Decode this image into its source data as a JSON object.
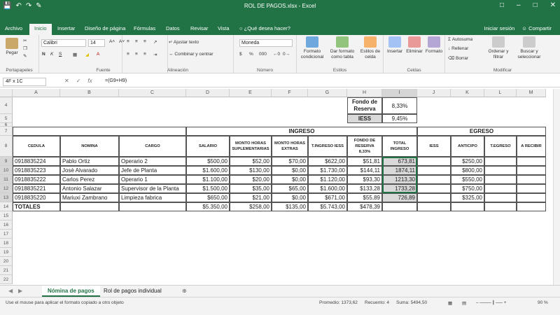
{
  "window": {
    "title": "ROL DE PAGOS.xlsx - Excel"
  },
  "tabs": [
    "Archivo",
    "Inicio",
    "Insertar",
    "Diseño de página",
    "Fórmulas",
    "Datos",
    "Revisar",
    "Vista"
  ],
  "tell_me": "¿Qué desea hacer?",
  "account": {
    "signin": "Iniciar sesión",
    "share": "Compartir"
  },
  "ribbon": {
    "clipboard": {
      "label": "Portapapeles",
      "paste": "Pegar"
    },
    "font": {
      "label": "Fuente",
      "name": "Calibri",
      "size": "14"
    },
    "alignment": {
      "label": "Alineación",
      "wrap": "Ajustar texto",
      "merge": "Combinar y centrar"
    },
    "number": {
      "label": "Número",
      "format": "Moneda"
    },
    "styles": {
      "label": "Estilos",
      "cond": "Formato condicional",
      "table": "Dar formato como tabla",
      "cell": "Estilos de celda"
    },
    "cells": {
      "label": "Celdas",
      "insert": "Insertar",
      "delete": "Eliminar",
      "format": "Formato"
    },
    "editing": {
      "label": "Modificar",
      "autosum": "Autosuma",
      "fill": "Rellenar",
      "clear": "Borrar",
      "sort": "Ordenar y filtrar",
      "find": "Buscar y seleccionar"
    }
  },
  "formula_bar": {
    "name_box": "4F x 1C",
    "formula": "=(G9+H9)"
  },
  "columns": [
    "A",
    "B",
    "C",
    "D",
    "E",
    "F",
    "G",
    "H",
    "I",
    "J",
    "K",
    "L",
    "M"
  ],
  "rows": [
    "4",
    "5",
    "6",
    "7",
    "8",
    "9",
    "10",
    "11",
    "12",
    "13",
    "14",
    "15",
    "16",
    "17",
    "18",
    "19",
    "20",
    "21",
    "22"
  ],
  "top_block": {
    "fondo_label": "Fondo de Reserva",
    "fondo_value": "8,33%",
    "iess_label": "IESS",
    "iess_value": "9,45%"
  },
  "ingreso_title": "INGRESO",
  "egreso_title": "EGRESO",
  "headers": [
    "CEDULA",
    "NOMINA",
    "CARGO",
    "SALARIO",
    "MONTO HORAS SUPLEMENTARIAS",
    "MONTO HORAS EXTRAS",
    "T.INGRESO IESS",
    "FONDO DE RESERVA 8,33%",
    "TOTAL INGRESO",
    "IESS",
    "ANTICIPO",
    "T.EGRESO",
    "A RECIBIR"
  ],
  "data": [
    [
      "0918835224",
      "Pablo Ortiz",
      "Operario 2",
      "$500,00",
      "$52,00",
      "$70,00",
      "$622,00",
      "$51,81",
      "673,81",
      "",
      "$250,00",
      "",
      ""
    ],
    [
      "0918835223",
      "Josè Alvarado",
      "Jefe de Planta",
      "$1.600,00",
      "$130,00",
      "$0,00",
      "$1.730,00",
      "$144,11",
      "1874,11",
      "",
      "$800,00",
      "",
      ""
    ],
    [
      "0918835222",
      "Carlos Perez",
      "Operario 1",
      "$1.100,00",
      "$20,00",
      "$0,00",
      "$1.120,00",
      "$93,30",
      "1213,30",
      "",
      "$550,00",
      "",
      ""
    ],
    [
      "0918835221",
      "Antonio Salazar",
      "Supervisor de la Planta",
      "$1.500,00",
      "$35,00",
      "$65,00",
      "$1.600,00",
      "$133,28",
      "1733,28",
      "",
      "$750,00",
      "",
      ""
    ],
    [
      "0918835220",
      "Mariuxi Zambrano",
      "Limpieza fabrica",
      "$650,00",
      "$21,00",
      "$0,00",
      "$671,00",
      "$55,89",
      "726,89",
      "",
      "$325,00",
      "",
      ""
    ]
  ],
  "totals": [
    "TOTALES",
    "",
    "",
    "$5.350,00",
    "$258,00",
    "$135,00",
    "$5.743,00",
    "$478,39",
    "",
    "",
    "",
    "",
    ""
  ],
  "sheets": [
    "Nómina de pagos",
    "Rol de pagos individual"
  ],
  "status": {
    "message": "Use el mouse para aplicar el formato copiado a otro objeto",
    "average": "Promedio: 1373,62",
    "count": "Recuento: 4",
    "sum": "Suma: 5494,50",
    "zoom": "90 %"
  }
}
